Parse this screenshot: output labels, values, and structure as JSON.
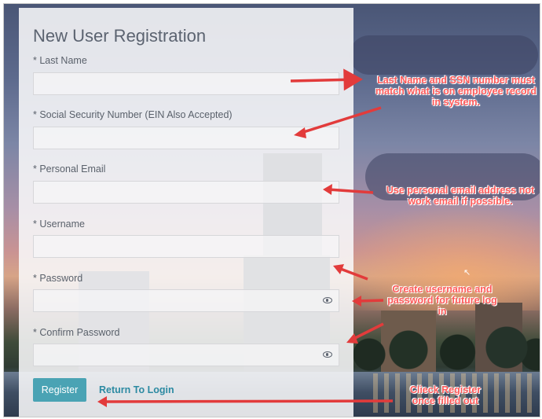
{
  "form": {
    "title": "New User Registration",
    "fields": [
      {
        "label": "* Last Name",
        "value": "",
        "has_eye": false
      },
      {
        "label": "* Social Security Number (EIN Also Accepted)",
        "value": "",
        "has_eye": false
      },
      {
        "label": "* Personal Email",
        "value": "",
        "has_eye": false
      },
      {
        "label": "* Username",
        "value": "",
        "has_eye": false
      },
      {
        "label": "* Password",
        "value": "",
        "has_eye": true
      },
      {
        "label": "* Confirm Password",
        "value": "",
        "has_eye": true
      }
    ],
    "register_label": "Register",
    "return_label": "Return To Login"
  },
  "annotations": {
    "ssn_note": "Last Name and SSN number must match what is on employee record in system.",
    "email_note": "Use personal email address not work email if possible.",
    "password_note": "Create username and password for future log in",
    "register_note": "Clieck Register once filled out"
  },
  "colors": {
    "accent": "#4aa3b4",
    "link": "#2c8aa2",
    "annotation": "#ff5959",
    "arrow": "#e23b3b"
  },
  "icons": [
    "eye-icon",
    "cursor-icon"
  ]
}
